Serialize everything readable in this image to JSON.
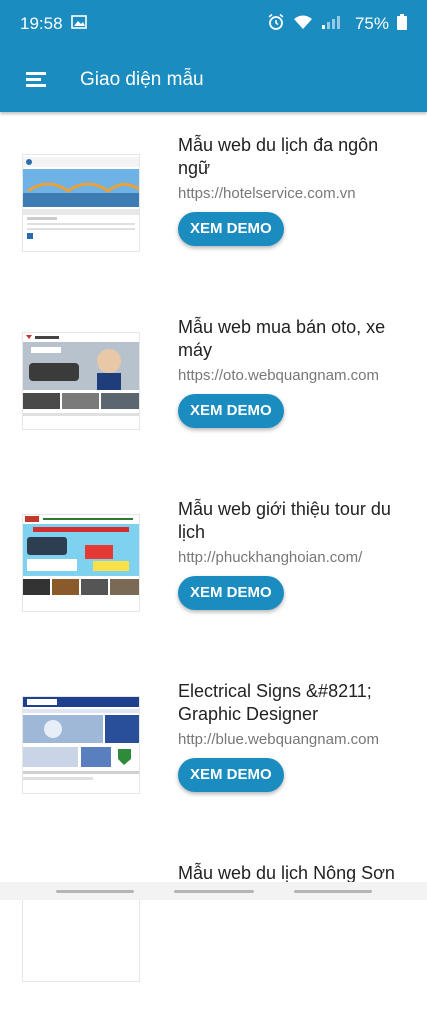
{
  "status": {
    "time": "19:58",
    "battery": "75%"
  },
  "app_bar": {
    "title": "Giao diện mẫu"
  },
  "items": [
    {
      "title": "Mẫu web du lịch đa ngôn ngữ",
      "url": "https://hotelservice.com.vn",
      "button": "XEM DEMO"
    },
    {
      "title": "Mẫu web mua bán oto, xe máy",
      "url": "https://oto.webquangnam.com",
      "button": "XEM DEMO"
    },
    {
      "title": "Mẫu web giới thiệu tour du lịch",
      "url": "http://phuckhanghoian.com/",
      "button": "XEM DEMO"
    },
    {
      "title": "Electrical Signs &#8211; Graphic Designer",
      "url": "http://blue.webquangnam.com",
      "button": "XEM DEMO"
    },
    {
      "title": "Mẫu web du lịch Nông Sơn"
    }
  ]
}
